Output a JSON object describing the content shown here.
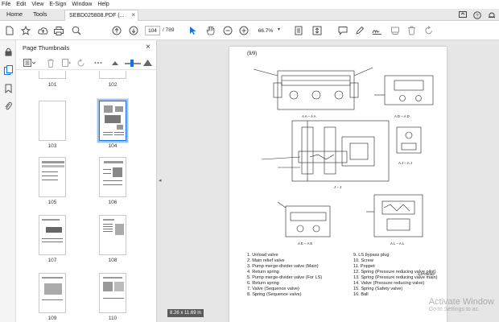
{
  "menu": [
    "File",
    "Edit",
    "View",
    "E-Sign",
    "Window",
    "Help"
  ],
  "tabs": {
    "home": "Home",
    "tools": "Tools",
    "document": "SEBD025808.PDF (...",
    "close": "×"
  },
  "toolbar": {
    "page_current": "104",
    "page_total": "/ 789",
    "zoom": "66.7%"
  },
  "panel": {
    "title": "Page Thumbnails",
    "close": "×",
    "thumbnails": [
      {
        "label": "101"
      },
      {
        "label": "102"
      },
      {
        "label": "103"
      },
      {
        "label": "104",
        "selected": true
      },
      {
        "label": "105"
      },
      {
        "label": "106"
      },
      {
        "label": "107"
      },
      {
        "label": "108"
      },
      {
        "label": "109"
      },
      {
        "label": "110"
      }
    ]
  },
  "status": {
    "page_size": "8.26 x 11.69 in"
  },
  "document": {
    "page_number": "(9/9)",
    "view_labels": [
      "A A – A A",
      "A D – A D",
      "A J – A J",
      "J – J",
      "A E – A E",
      "A L – A L"
    ],
    "figure_code": "SJP05069",
    "legend_left": [
      "1.   Unload valve",
      "2.   Main relief valve",
      "3.   Pump merge-divider valve (Main)",
      "4.   Return spring",
      "5.   Pump merge-divider valve (For LS)",
      "6.   Return spring",
      "7.   Valve (Sequence valve)",
      "8.   Spring (Sequence valve)"
    ],
    "legend_right": [
      "9.    LS bypass plug",
      "10.  Screw",
      "11.  Poppet",
      "12.  Spring (Pressure reducing valve pilot)",
      "13.  Spring (Pressure reducing valve main)",
      "14.  Valve (Pressure reducing valve)",
      "15.  Spring (Safety valve)",
      "16.  Ball"
    ]
  },
  "watermark": {
    "line1": "Activate Window",
    "line2": "Go to Settings to ac"
  }
}
